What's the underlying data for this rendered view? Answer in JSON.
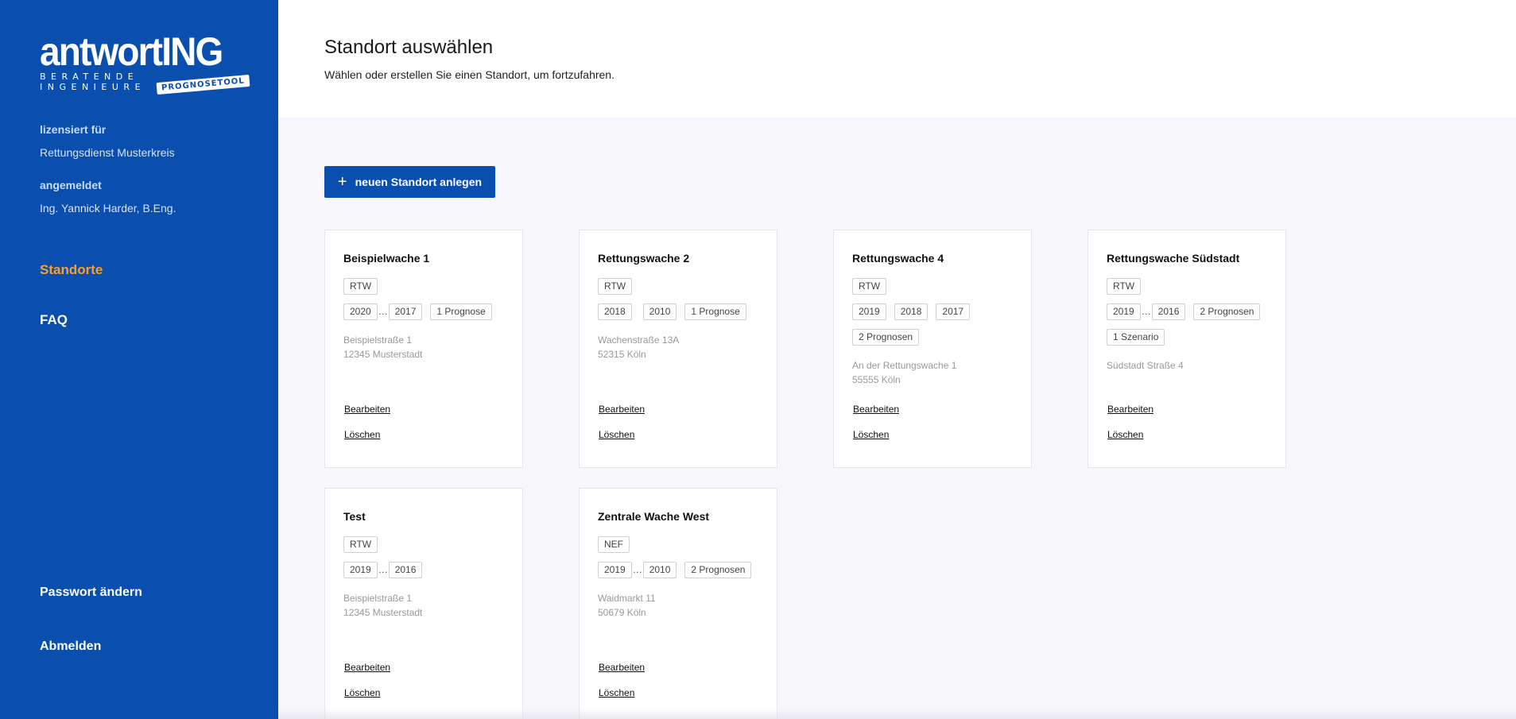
{
  "brand": {
    "name": "antwortING",
    "subtitle": "BERATENDE INGENIEURE",
    "tag": "PROGNOSETOOL"
  },
  "sidebar": {
    "license_label": "lizensiert für",
    "license_value": "Rettungsdienst Musterkreis",
    "user_label": "angemeldet",
    "user_value": "Ing. Yannick Harder, B.Eng.",
    "nav": {
      "standorte": "Standorte",
      "faq": "FAQ"
    },
    "change_password": "Passwort ändern",
    "logout": "Abmelden"
  },
  "header": {
    "title": "Standort auswählen",
    "subtitle": "Wählen oder erstellen Sie einen Standort, um fortzufahren."
  },
  "add_button": {
    "icon": "plus-icon",
    "label": "neuen Standort anlegen"
  },
  "card_actions": {
    "edit": "Bearbeiten",
    "delete": "Löschen"
  },
  "locations": [
    {
      "name": "Beispielwache 1",
      "vehicle": "RTW",
      "years": [
        "2020",
        "…",
        "2017"
      ],
      "forecasts": "1 Prognose",
      "address": [
        "Beispielstraße 1",
        "12345 Musterstadt"
      ]
    },
    {
      "name": "Rettungswache 2",
      "vehicle": "RTW",
      "years": [
        "2018",
        "2010"
      ],
      "forecasts": "1 Prognose",
      "address": [
        "Wachenstraße 13A",
        "52315 Köln"
      ]
    },
    {
      "name": "Rettungswache 4",
      "vehicle": "RTW",
      "years": [
        "2019",
        "2018",
        "2017"
      ],
      "forecasts": "2 Prognosen",
      "address": [
        "An der Rettungswache 1",
        "55555 Köln"
      ]
    },
    {
      "name": "Rettungswache Südstadt",
      "vehicle": "RTW",
      "years": [
        "2019",
        "…",
        "2016"
      ],
      "forecasts": "2 Prognosen",
      "scenarios": "1 Szenario",
      "address": [
        "Südstadt Straße 4"
      ]
    },
    {
      "name": "Test",
      "vehicle": "RTW",
      "years": [
        "2019",
        "…",
        "2016"
      ],
      "address": [
        "Beispielstraße 1",
        "12345 Musterstadt"
      ]
    },
    {
      "name": "Zentrale Wache West",
      "vehicle": "NEF",
      "years": [
        "2019",
        "…",
        "2010"
      ],
      "forecasts": "2 Prognosen",
      "address": [
        "Waidmarkt 11",
        "50679 Köln"
      ]
    }
  ],
  "colors": {
    "primary": "#0a4fae",
    "active_nav": "#f7a030"
  }
}
